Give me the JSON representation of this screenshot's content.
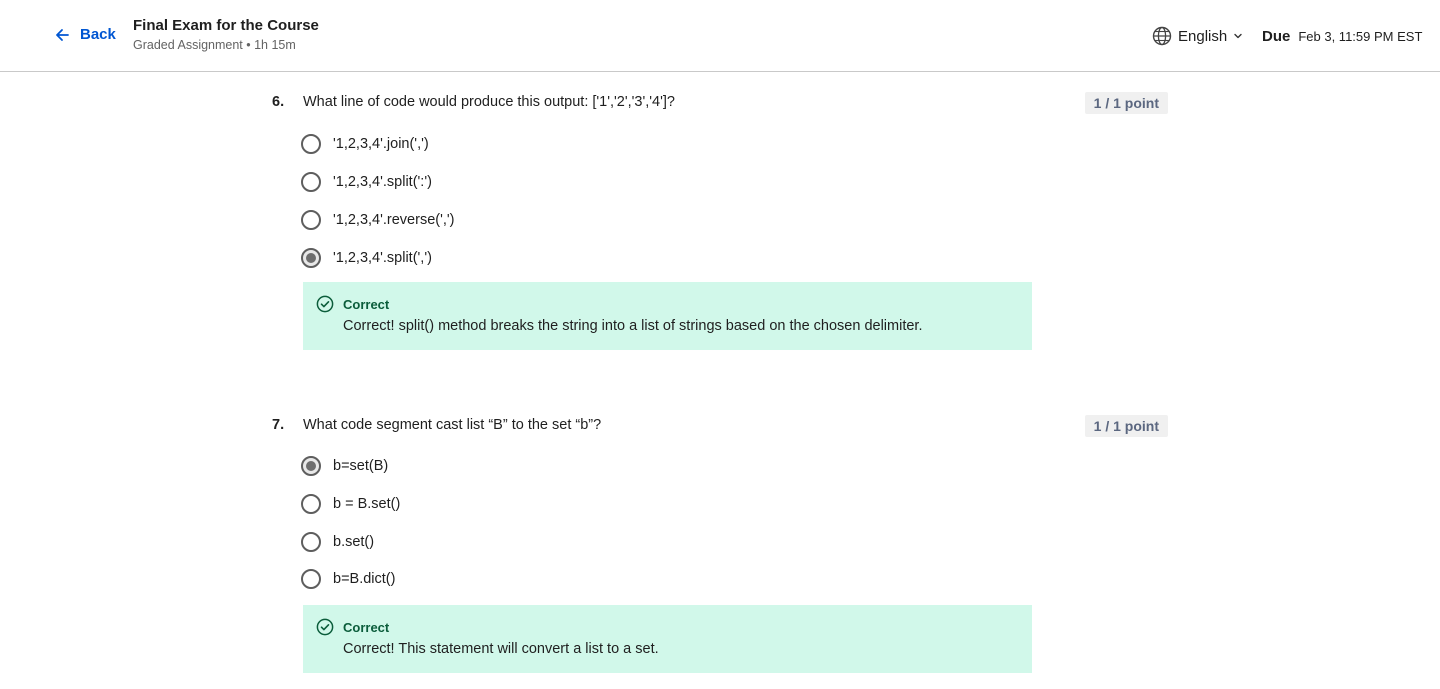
{
  "header": {
    "back_label": "Back",
    "title": "Final Exam for the Course",
    "subtitle": "Graded Assignment • 1h 15m",
    "language": "English",
    "due_label": "Due",
    "due_value": "Feb 3, 11:59 PM EST"
  },
  "questions": [
    {
      "number": "6.",
      "text": "What line of code would produce this output: ['1','2','3','4']?",
      "points": "1 / 1 point",
      "options": [
        {
          "label": "'1,2,3,4'.join(',')",
          "selected": false
        },
        {
          "label": "'1,2,3,4'.split(':')",
          "selected": false
        },
        {
          "label": "'1,2,3,4'.reverse(',')",
          "selected": false
        },
        {
          "label": "'1,2,3,4'.split(',')",
          "selected": true
        }
      ],
      "feedback": {
        "title": "Correct",
        "text": "Correct! split() method breaks the string into a list of strings based on the chosen delimiter."
      }
    },
    {
      "number": "7.",
      "text": "What code segment cast list “B” to the set “b”?",
      "points": "1 / 1 point",
      "options": [
        {
          "label": "b=set(B)",
          "selected": true
        },
        {
          "label": "b = B.set()",
          "selected": false
        },
        {
          "label": "b.set()",
          "selected": false
        },
        {
          "label": "b=B.dict()",
          "selected": false
        }
      ],
      "feedback": {
        "title": "Correct",
        "text": "Correct! This statement will convert a list to a set."
      }
    }
  ],
  "colors": {
    "accent": "#0056d2",
    "feedback_bg": "#d1f8ea",
    "feedback_title": "#0b5d3b"
  }
}
